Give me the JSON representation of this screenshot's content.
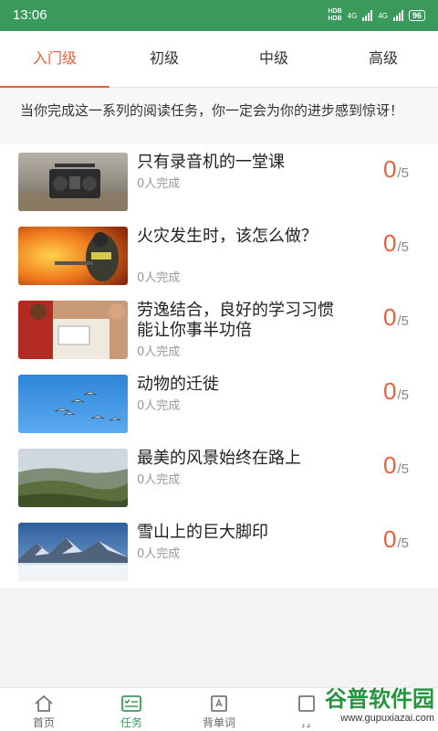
{
  "status_bar": {
    "time": "13:06",
    "network_a": "4G",
    "network_b": "4G",
    "hd_a": "HDB",
    "hd_b": "HDB",
    "battery": "96"
  },
  "tabs": [
    {
      "label": "入门级",
      "active": true
    },
    {
      "label": "初级",
      "active": false
    },
    {
      "label": "中级",
      "active": false
    },
    {
      "label": "高级",
      "active": false
    }
  ],
  "intro": "当你完成这一系列的阅读任务，你一定会为你的进步感到惊讶！",
  "items": [
    {
      "title": "只有录音机的一堂课",
      "done": "0人完成",
      "score": "0",
      "total": "/5",
      "image": "radio-photo"
    },
    {
      "title": "火灾发生时，该怎么做？",
      "done": "0人完成",
      "score": "0",
      "total": "/5",
      "image": "firefighter-photo"
    },
    {
      "title": "劳逸结合，良好的学习习惯能让你事半功倍",
      "done": "0人完成",
      "score": "0",
      "total": "/5",
      "image": "study-desk-photo"
    },
    {
      "title": "动物的迁徙",
      "done": "0人完成",
      "score": "0",
      "total": "/5",
      "image": "birds-sky-photo"
    },
    {
      "title": "最美的风景始终在路上",
      "done": "0人完成",
      "score": "0",
      "total": "/5",
      "image": "landscape-photo"
    },
    {
      "title": "雪山上的巨大脚印",
      "done": "0人完成",
      "score": "0",
      "total": "/5",
      "image": "snow-mountain-photo"
    }
  ],
  "bottom_nav": [
    {
      "label": "首页",
      "icon": "home-icon",
      "active": false
    },
    {
      "label": "任务",
      "icon": "task-icon",
      "active": true
    },
    {
      "label": "背单词",
      "icon": "word-card-icon",
      "active": false
    },
    {
      "label": "打",
      "icon": "checkin-icon",
      "active": false
    }
  ],
  "watermark": {
    "title": "谷普软件园",
    "url": "www.gupuxiazai.com"
  },
  "colors": {
    "brand_green": "#3a9a5b",
    "accent_orange": "#e8603c"
  }
}
